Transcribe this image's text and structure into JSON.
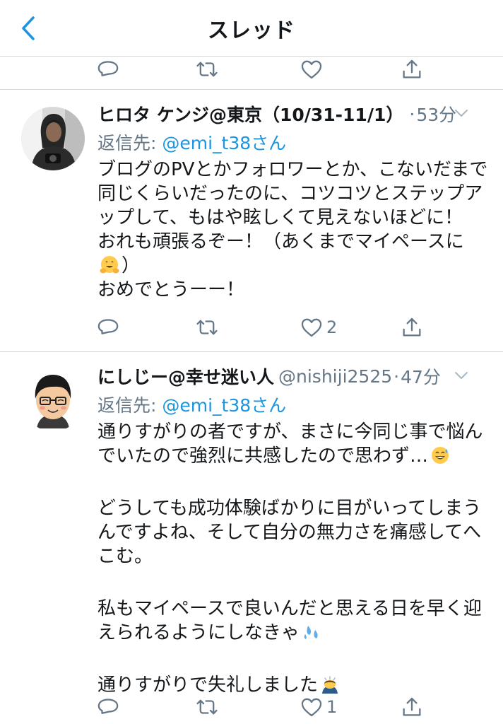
{
  "nav": {
    "title": "スレッド",
    "back_icon": "chevron-left-icon"
  },
  "colors": {
    "accent": "#1b95e0",
    "secondary": "#657786",
    "divider": "#d4d7da"
  },
  "top_actions": {
    "reply_icon": "reply-icon",
    "retweet_icon": "retweet-icon",
    "like_icon": "heart-icon",
    "share_icon": "share-icon"
  },
  "tweets": [
    {
      "name": "ヒロタ ケンジ@東京（10/31-11/1）",
      "handle": "",
      "dot": "·",
      "time": "53分",
      "reply_prefix": "返信先: ",
      "reply_to": "@emi_t38さん",
      "lines": [
        "ブログのPVとかフォロワーとか、こないだまで",
        "同じくらいだったのに、コツコツとステップア",
        "ップして、もはや眩しくて見えないほどに！",
        "おれも頑張るぞー！（あくまでマイペースに",
        "）",
        "おめでとうーー！"
      ],
      "emojis": [
        "hugging-face-emoji"
      ],
      "likes": "2"
    },
    {
      "name": "にしじー@幸せ迷い人",
      "handle": "@nishiji2525",
      "dot": "·",
      "time": "47分",
      "reply_prefix": "返信先: ",
      "reply_to": "@emi_t38さん",
      "lines": [
        "通りすがりの者ですが、まさに今同じ事で悩ん",
        "でいたので強烈に共感したので思わず…",
        "どうしても成功体験ばかりに目がいってしまう",
        "んですよね、そして自分の無力さを痛感してへ",
        "こむ。",
        "私もマイペースで良いんだと思える日を早く迎",
        "えられるようにしなきゃ",
        "通りすがりで失礼しました"
      ],
      "emojis": [
        "grinning-sweat-emoji",
        "sweat-droplets-emoji",
        "bowing-person-emoji"
      ],
      "likes": "1"
    }
  ]
}
